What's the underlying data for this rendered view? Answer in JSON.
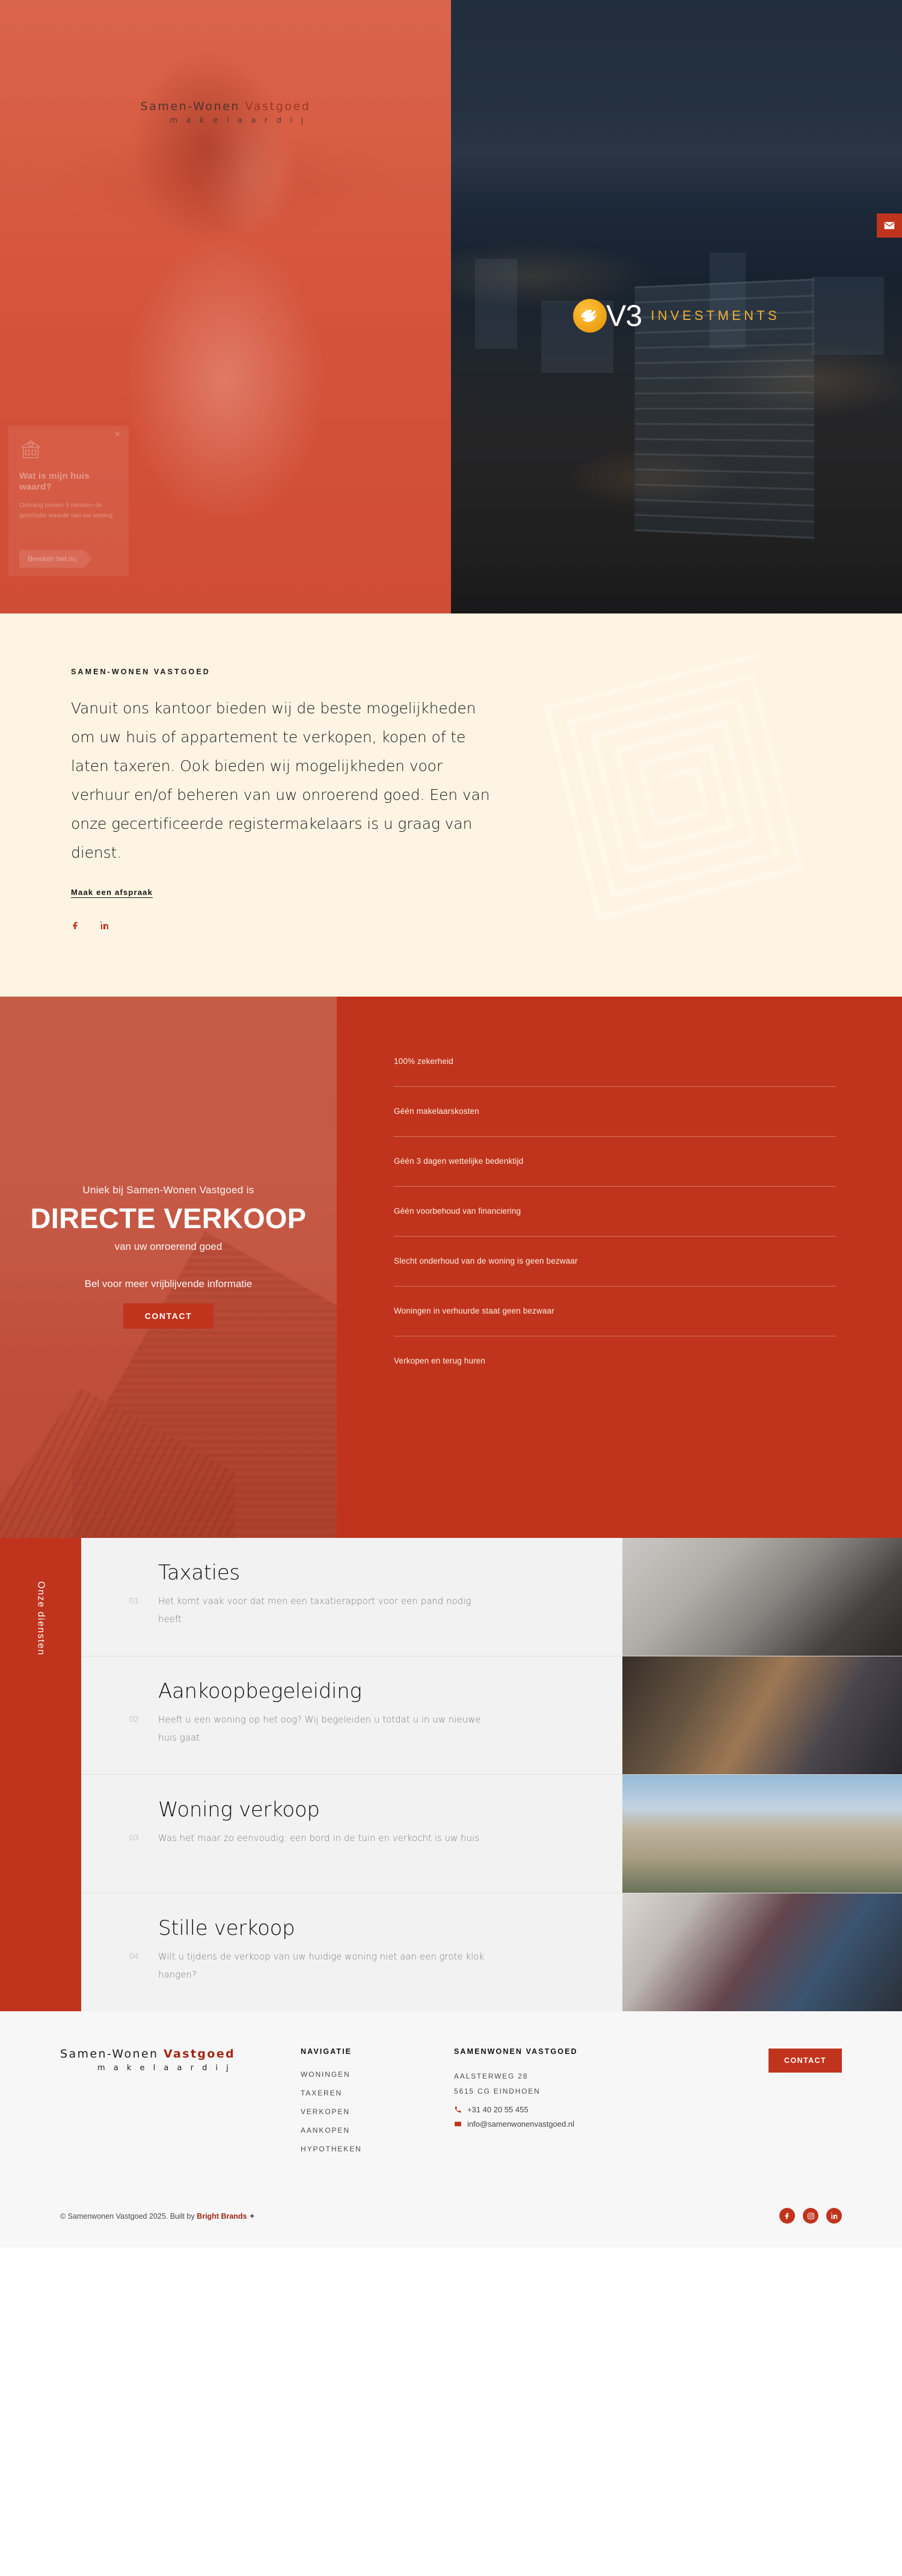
{
  "hero": {
    "logo_line1_a": "Samen-Wonen ",
    "logo_line1_b": "Vastgoed",
    "logo_line2": "m a k e l a a r d i j",
    "partner_logo": {
      "word": "V3",
      "sub": "INVESTMENTS"
    },
    "mail_button_label": "mail-button",
    "value_widget": {
      "close_label": "×",
      "title": "Wat is mijn huis waard?",
      "subtitle": "Ontvang binnen 5 minuten de geschatte waarde van uw woning",
      "button": "Bereken het nu"
    }
  },
  "intro": {
    "eyebrow": "SAMEN-WONEN VASTGOED",
    "body": "Vanuit ons kantoor bieden wij de beste mogelijkheden om uw huis of appartement te verkopen, kopen of te laten taxeren. Ook bieden wij mogelijkheden voor verhuur en/of beheren van uw onroerend goed. Een van onze gecertificeerde registermakelaars is u graag van dienst.",
    "link": "Maak een afspraak",
    "socials": [
      "facebook-icon",
      "linkedin-icon"
    ]
  },
  "direct_sale": {
    "kicker": "Uniek bij Samen-Wonen Vastgoed is",
    "title": "DIRECTE VERKOOP",
    "subtitle": "van uw onroerend goed",
    "call_text": "Bel voor meer vrijblijvende informatie",
    "button": "CONTACT",
    "benefits": [
      "100% zekerheid",
      "Géén makelaarskosten",
      "Géén 3 dagen wettelijke bedenktijd",
      "Géén voorbehoud van financiering",
      "Slecht onderhoud van de woning is geen bezwaar",
      "Woningen in verhuurde staat geen bezwaar",
      "Verkopen en terug huren"
    ]
  },
  "services": {
    "rail_label": "Onze diensten",
    "items": [
      {
        "number": "01",
        "title": "Taxaties",
        "desc": "Het komt vaak voor dat men een taxatierapport voor een pand nodig heeft",
        "image": "valuation-photo"
      },
      {
        "number": "02",
        "title": "Aankoopbegeleiding",
        "desc": "Heeft u een woning op het oog? Wij begeleiden u totdat u in uw nieuwe huis gaat",
        "image": "advisors-meeting-photo"
      },
      {
        "number": "03",
        "title": "Woning verkoop",
        "desc": "Was het maar zo eenvoudig: een bord in de tuin en verkocht is uw huis",
        "image": "modern-houses-photo"
      },
      {
        "number": "04",
        "title": "Stille verkoop",
        "desc": "Wilt u tijdens de verkoop van uw huidige woning niet aan een grote klok hangen?",
        "image": "couple-laptop-photo"
      }
    ]
  },
  "footer": {
    "logo_line1_a": "Samen-Wonen ",
    "logo_line1_b": "Vastgoed",
    "logo_line2": "m a k e l a a r d i j",
    "nav_heading": "NAVIGATIE",
    "nav_items": [
      "WONINGEN",
      "TAXEREN",
      "VERKOPEN",
      "AANKOPEN",
      "HYPOTHEKEN"
    ],
    "contact_heading": "SAMENWONEN VASTGOED",
    "address_line1": "AALSTERWEG 28",
    "address_line2": "5615 CG EINDHOEN",
    "phone": "+31 40 20 55 455",
    "email": "info@samenwonenvastgoed.nl",
    "cta": "CONTACT",
    "copyright_prefix": "© Samenwonen Vastgoed 2025. Built by ",
    "copyright_brand": "Bright Brands",
    "copyright_suffix": " ✦",
    "socials": [
      "facebook-icon",
      "instagram-icon",
      "linkedin-icon"
    ]
  },
  "colors": {
    "brand_red": "#c0341d",
    "cream": "#fdf4e3",
    "gold": "#f0b235"
  }
}
